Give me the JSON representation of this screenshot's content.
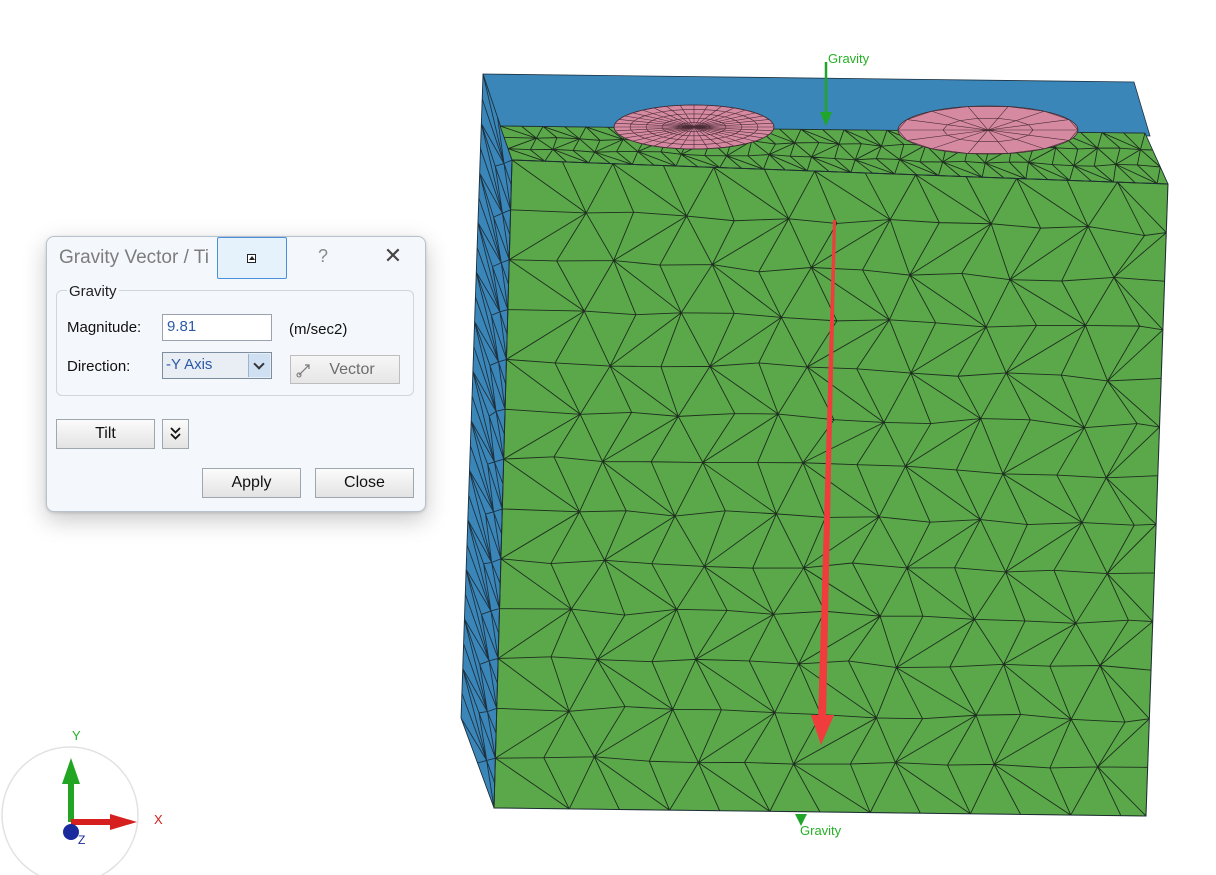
{
  "viewport": {
    "gravity_label_top": "Gravity",
    "gravity_label_bottom": "Gravity",
    "axis_y": "Y",
    "axis_x": "X",
    "axis_z": "Z",
    "colors": {
      "mesh_front": "#5aa84a",
      "mesh_side": "#3b86b8",
      "mesh_circle": "#d58aa2",
      "gravity_arrow": "#f03c3c",
      "gravity_marker": "#1fa52a",
      "axis_x": "#d62020",
      "axis_y": "#22a522",
      "axis_z": "#1a2a9c"
    }
  },
  "dialog": {
    "title": "Gravity Vector / Ti",
    "pin_icon": "pin-window-icon",
    "help_label": "?",
    "close_glyph": "✕",
    "group_title": "Gravity",
    "magnitude_label": "Magnitude:",
    "magnitude_value": "9.81",
    "unit": "(m/sec2)",
    "direction_label": "Direction:",
    "direction_value": "-Y Axis",
    "vector_button": "Vector",
    "tilt_button": "Tilt",
    "expand_icon": "double-chevron-down-icon",
    "apply_button": "Apply",
    "close_button": "Close"
  }
}
